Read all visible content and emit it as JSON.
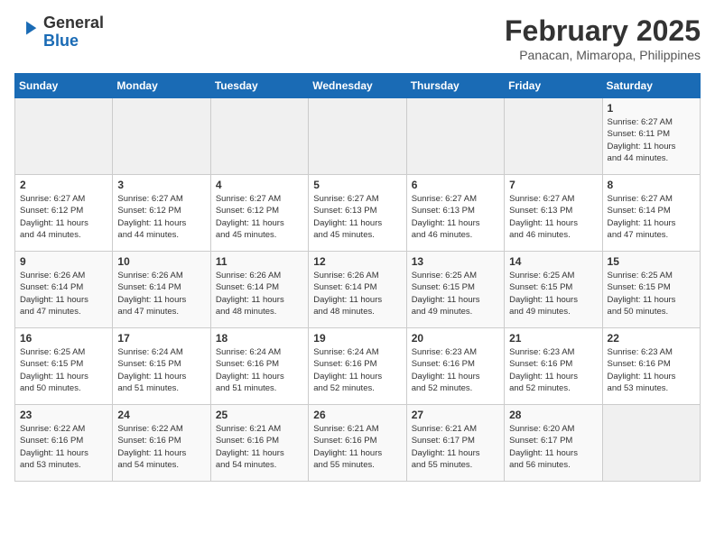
{
  "header": {
    "logo_general": "General",
    "logo_blue": "Blue",
    "month_title": "February 2025",
    "location": "Panacan, Mimaropa, Philippines"
  },
  "weekdays": [
    "Sunday",
    "Monday",
    "Tuesday",
    "Wednesday",
    "Thursday",
    "Friday",
    "Saturday"
  ],
  "weeks": [
    [
      {
        "day": "",
        "info": ""
      },
      {
        "day": "",
        "info": ""
      },
      {
        "day": "",
        "info": ""
      },
      {
        "day": "",
        "info": ""
      },
      {
        "day": "",
        "info": ""
      },
      {
        "day": "",
        "info": ""
      },
      {
        "day": "1",
        "info": "Sunrise: 6:27 AM\nSunset: 6:11 PM\nDaylight: 11 hours\nand 44 minutes."
      }
    ],
    [
      {
        "day": "2",
        "info": "Sunrise: 6:27 AM\nSunset: 6:12 PM\nDaylight: 11 hours\nand 44 minutes."
      },
      {
        "day": "3",
        "info": "Sunrise: 6:27 AM\nSunset: 6:12 PM\nDaylight: 11 hours\nand 44 minutes."
      },
      {
        "day": "4",
        "info": "Sunrise: 6:27 AM\nSunset: 6:12 PM\nDaylight: 11 hours\nand 45 minutes."
      },
      {
        "day": "5",
        "info": "Sunrise: 6:27 AM\nSunset: 6:13 PM\nDaylight: 11 hours\nand 45 minutes."
      },
      {
        "day": "6",
        "info": "Sunrise: 6:27 AM\nSunset: 6:13 PM\nDaylight: 11 hours\nand 46 minutes."
      },
      {
        "day": "7",
        "info": "Sunrise: 6:27 AM\nSunset: 6:13 PM\nDaylight: 11 hours\nand 46 minutes."
      },
      {
        "day": "8",
        "info": "Sunrise: 6:27 AM\nSunset: 6:14 PM\nDaylight: 11 hours\nand 47 minutes."
      }
    ],
    [
      {
        "day": "9",
        "info": "Sunrise: 6:26 AM\nSunset: 6:14 PM\nDaylight: 11 hours\nand 47 minutes."
      },
      {
        "day": "10",
        "info": "Sunrise: 6:26 AM\nSunset: 6:14 PM\nDaylight: 11 hours\nand 47 minutes."
      },
      {
        "day": "11",
        "info": "Sunrise: 6:26 AM\nSunset: 6:14 PM\nDaylight: 11 hours\nand 48 minutes."
      },
      {
        "day": "12",
        "info": "Sunrise: 6:26 AM\nSunset: 6:14 PM\nDaylight: 11 hours\nand 48 minutes."
      },
      {
        "day": "13",
        "info": "Sunrise: 6:25 AM\nSunset: 6:15 PM\nDaylight: 11 hours\nand 49 minutes."
      },
      {
        "day": "14",
        "info": "Sunrise: 6:25 AM\nSunset: 6:15 PM\nDaylight: 11 hours\nand 49 minutes."
      },
      {
        "day": "15",
        "info": "Sunrise: 6:25 AM\nSunset: 6:15 PM\nDaylight: 11 hours\nand 50 minutes."
      }
    ],
    [
      {
        "day": "16",
        "info": "Sunrise: 6:25 AM\nSunset: 6:15 PM\nDaylight: 11 hours\nand 50 minutes."
      },
      {
        "day": "17",
        "info": "Sunrise: 6:24 AM\nSunset: 6:15 PM\nDaylight: 11 hours\nand 51 minutes."
      },
      {
        "day": "18",
        "info": "Sunrise: 6:24 AM\nSunset: 6:16 PM\nDaylight: 11 hours\nand 51 minutes."
      },
      {
        "day": "19",
        "info": "Sunrise: 6:24 AM\nSunset: 6:16 PM\nDaylight: 11 hours\nand 52 minutes."
      },
      {
        "day": "20",
        "info": "Sunrise: 6:23 AM\nSunset: 6:16 PM\nDaylight: 11 hours\nand 52 minutes."
      },
      {
        "day": "21",
        "info": "Sunrise: 6:23 AM\nSunset: 6:16 PM\nDaylight: 11 hours\nand 52 minutes."
      },
      {
        "day": "22",
        "info": "Sunrise: 6:23 AM\nSunset: 6:16 PM\nDaylight: 11 hours\nand 53 minutes."
      }
    ],
    [
      {
        "day": "23",
        "info": "Sunrise: 6:22 AM\nSunset: 6:16 PM\nDaylight: 11 hours\nand 53 minutes."
      },
      {
        "day": "24",
        "info": "Sunrise: 6:22 AM\nSunset: 6:16 PM\nDaylight: 11 hours\nand 54 minutes."
      },
      {
        "day": "25",
        "info": "Sunrise: 6:21 AM\nSunset: 6:16 PM\nDaylight: 11 hours\nand 54 minutes."
      },
      {
        "day": "26",
        "info": "Sunrise: 6:21 AM\nSunset: 6:16 PM\nDaylight: 11 hours\nand 55 minutes."
      },
      {
        "day": "27",
        "info": "Sunrise: 6:21 AM\nSunset: 6:17 PM\nDaylight: 11 hours\nand 55 minutes."
      },
      {
        "day": "28",
        "info": "Sunrise: 6:20 AM\nSunset: 6:17 PM\nDaylight: 11 hours\nand 56 minutes."
      },
      {
        "day": "",
        "info": ""
      }
    ]
  ]
}
